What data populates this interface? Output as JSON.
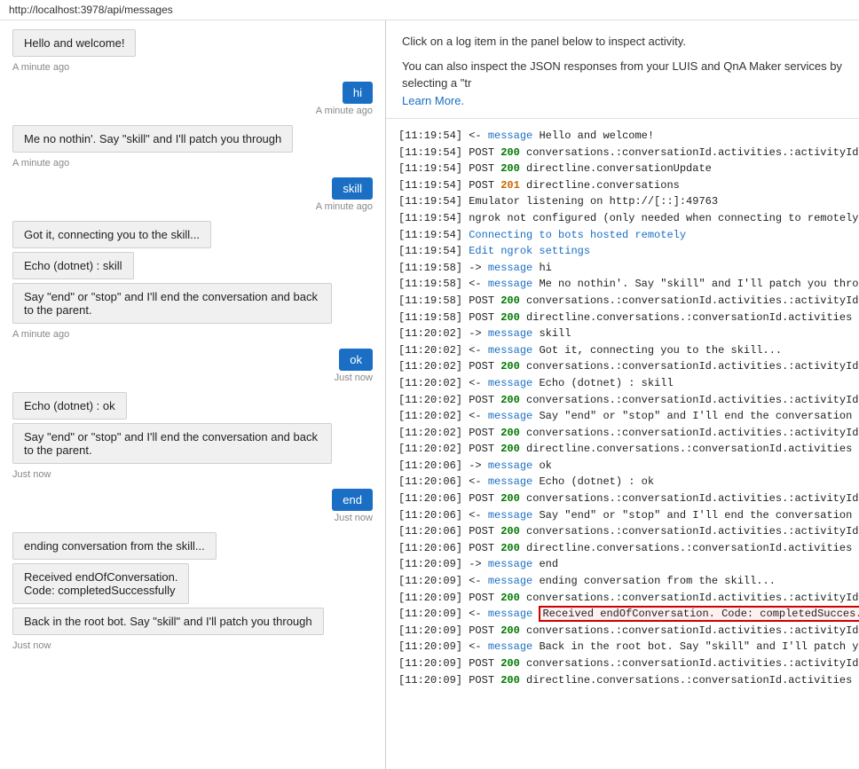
{
  "topbar": {
    "url": "http://localhost:3978/api/messages"
  },
  "info": {
    "line1": "Click on a log item in the panel below to inspect activity.",
    "line2": "You can also inspect the JSON responses from your LUIS and QnA Maker services by selecting a \"tr",
    "learnmore": "Learn More."
  },
  "chat": {
    "messages": [
      {
        "type": "bot",
        "text": "Hello and welcome!",
        "time": "A minute ago"
      },
      {
        "type": "user",
        "text": "hi",
        "time": "A minute ago"
      },
      {
        "type": "bot",
        "text": "Me no nothin'. Say \"skill\" and I'll patch you through",
        "time": "A minute ago"
      },
      {
        "type": "user",
        "text": "skill",
        "time": "A minute ago"
      },
      {
        "type": "bot-multi",
        "texts": [
          "Got it, connecting you to the skill...",
          "Echo (dotnet) : skill",
          "Say \"end\" or \"stop\" and I'll end the conversation and back to the parent."
        ],
        "time": "A minute ago"
      },
      {
        "type": "user",
        "text": "ok",
        "time": "Just now"
      },
      {
        "type": "bot-multi",
        "texts": [
          "Echo (dotnet) : ok",
          "Say \"end\" or \"stop\" and I'll end the conversation and back to the parent."
        ],
        "time": "Just now"
      },
      {
        "type": "user",
        "text": "end",
        "time": "Just now"
      },
      {
        "type": "bot-multi",
        "texts": [
          "ending conversation from the skill...",
          "Received endOfConversation.\nCode: completedSuccessfully",
          "Back in the root bot. Say \"skill\" and I'll patch you through"
        ],
        "time": "Just now"
      }
    ]
  },
  "log": {
    "entries": [
      {
        "time": "11:19:54",
        "dir": "<-",
        "type": "message",
        "rest": " Hello and welcome!",
        "link": true,
        "highlight": false,
        "status": null
      },
      {
        "time": "11:19:54",
        "dir": "POST",
        "type": "200",
        "rest": " conversations.:conversationId.activities.:activityId",
        "link": false,
        "highlight": false,
        "status": "200"
      },
      {
        "time": "11:19:54",
        "dir": "POST",
        "type": "200",
        "rest": " directline.conversationUpdate",
        "link": false,
        "highlight": false,
        "status": "200"
      },
      {
        "time": "11:19:54",
        "dir": "POST",
        "type": "201",
        "rest": " directline.conversations",
        "link": false,
        "highlight": false,
        "status": "201"
      },
      {
        "time": "11:19:54",
        "dir": "",
        "type": "",
        "rest": "Emulator listening on http://[::]:49763",
        "link": false,
        "highlight": false,
        "status": null
      },
      {
        "time": "11:19:54",
        "dir": "",
        "type": "",
        "rest": "ngrok not configured (only needed when connecting to remotely hoste",
        "link": false,
        "highlight": false,
        "status": null
      },
      {
        "time": "11:19:54",
        "dir": "",
        "type": "connecting",
        "rest": " to bots hosted remotely",
        "link": true,
        "linktext": "Connecting to bots hosted remotely",
        "highlight": false,
        "status": null
      },
      {
        "time": "11:19:54",
        "dir": "",
        "type": "ngrokedit",
        "rest": "",
        "link": true,
        "linktext": "Edit ngrok settings",
        "highlight": false,
        "status": null
      },
      {
        "time": "11:19:58",
        "dir": "->",
        "type": "message",
        "rest": " hi",
        "link": true,
        "highlight": false,
        "status": null
      },
      {
        "time": "11:19:58",
        "dir": "<-",
        "type": "message",
        "rest": " Me no nothin'. Say \"skill\" and I'll patch you thro...",
        "link": true,
        "highlight": false,
        "status": null
      },
      {
        "time": "11:19:58",
        "dir": "POST",
        "type": "200",
        "rest": " conversations.:conversationId.activities.:activityId",
        "link": false,
        "highlight": false,
        "status": "200"
      },
      {
        "time": "11:19:58",
        "dir": "POST",
        "type": "200",
        "rest": " directline.conversations.:conversationId.activities",
        "link": false,
        "highlight": false,
        "status": "200"
      },
      {
        "time": "11:20:02",
        "dir": "->",
        "type": "message",
        "rest": " skill",
        "link": true,
        "highlight": false,
        "status": null
      },
      {
        "time": "11:20:02",
        "dir": "<-",
        "type": "message",
        "rest": " Got it, connecting you to the skill...",
        "link": true,
        "highlight": false,
        "status": null
      },
      {
        "time": "11:20:02",
        "dir": "POST",
        "type": "200",
        "rest": " conversations.:conversationId.activities.:activityId",
        "link": false,
        "highlight": false,
        "status": "200"
      },
      {
        "time": "11:20:02",
        "dir": "<-",
        "type": "message",
        "rest": " Echo (dotnet) : skill",
        "link": true,
        "highlight": false,
        "status": null
      },
      {
        "time": "11:20:02",
        "dir": "POST",
        "type": "200",
        "rest": " conversations.:conversationId.activities.:activityId",
        "link": false,
        "highlight": false,
        "status": "200"
      },
      {
        "time": "11:20:02",
        "dir": "<-",
        "type": "message",
        "rest": " Say \"end\" or \"stop\" and I'll end the conversation ...",
        "link": true,
        "highlight": false,
        "status": null
      },
      {
        "time": "11:20:02",
        "dir": "POST",
        "type": "200",
        "rest": " conversations.:conversationId.activities.:activityId",
        "link": false,
        "highlight": false,
        "status": "200"
      },
      {
        "time": "11:20:02",
        "dir": "POST",
        "type": "200",
        "rest": " directline.conversations.:conversationId.activities",
        "link": false,
        "highlight": false,
        "status": "200"
      },
      {
        "time": "11:20:06",
        "dir": "->",
        "type": "message",
        "rest": " ok",
        "link": true,
        "highlight": false,
        "status": null
      },
      {
        "time": "11:20:06",
        "dir": "<-",
        "type": "message",
        "rest": " Echo (dotnet) : ok",
        "link": true,
        "highlight": false,
        "status": null
      },
      {
        "time": "11:20:06",
        "dir": "POST",
        "type": "200",
        "rest": " conversations.:conversationId.activities.:activityId",
        "link": false,
        "highlight": false,
        "status": "200"
      },
      {
        "time": "11:20:06",
        "dir": "<-",
        "type": "message",
        "rest": " Say \"end\" or \"stop\" and I'll end the conversation ...",
        "link": true,
        "highlight": false,
        "status": null
      },
      {
        "time": "11:20:06",
        "dir": "POST",
        "type": "200",
        "rest": " conversations.:conversationId.activities.:activityId",
        "link": false,
        "highlight": false,
        "status": "200"
      },
      {
        "time": "11:20:06",
        "dir": "POST",
        "type": "200",
        "rest": " directline.conversations.:conversationId.activities",
        "link": false,
        "highlight": false,
        "status": "200"
      },
      {
        "time": "11:20:09",
        "dir": "->",
        "type": "message",
        "rest": " end",
        "link": true,
        "highlight": false,
        "status": null
      },
      {
        "time": "11:20:09",
        "dir": "<-",
        "type": "message",
        "rest": " ending conversation from the skill...",
        "link": true,
        "highlight": false,
        "status": null
      },
      {
        "time": "11:20:09",
        "dir": "POST",
        "type": "200",
        "rest": " conversations.:conversationId.activities.:activityId",
        "link": false,
        "highlight": false,
        "status": "200"
      },
      {
        "time": "11:20:09",
        "dir": "<-",
        "type": "message",
        "rest": "Received endOfConversation. Code: completedSucces...",
        "link": true,
        "highlight": true,
        "status": null
      },
      {
        "time": "11:20:09",
        "dir": "POST",
        "type": "200",
        "rest": " conversations.:conversationId.activities.:activityId",
        "link": false,
        "highlight": false,
        "status": "200"
      },
      {
        "time": "11:20:09",
        "dir": "<-",
        "type": "message",
        "rest": " Back in the root bot. Say \"skill\" and I'll patch y...",
        "link": true,
        "highlight": false,
        "status": null
      },
      {
        "time": "11:20:09",
        "dir": "POST",
        "type": "200",
        "rest": " conversations.:conversationId.activities.:activityId",
        "link": false,
        "highlight": false,
        "status": "200"
      },
      {
        "time": "11:20:09",
        "dir": "POST",
        "type": "200",
        "rest": " directline.conversations.:conversationId.activities",
        "link": false,
        "highlight": false,
        "status": "200"
      }
    ]
  }
}
